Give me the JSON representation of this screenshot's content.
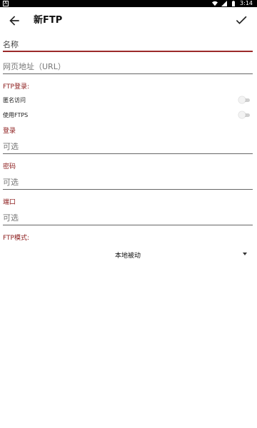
{
  "status_bar": {
    "left_icon": "A",
    "time": "3:14"
  },
  "app_bar": {
    "title": "新FTP"
  },
  "form": {
    "name_placeholder": "名称",
    "url_placeholder": "网页地址（URL）",
    "ftp_login_label": "FTP登录:",
    "anonymous_label": "匿名访问",
    "anonymous_enabled": false,
    "ftps_label": "使用FTPS",
    "ftps_enabled": false,
    "login_label": "登录",
    "login_placeholder": "可选",
    "password_label": "密码",
    "password_placeholder": "可选",
    "port_label": "端口",
    "port_placeholder": "可选",
    "ftp_mode_label": "FTP模式:",
    "ftp_mode_value": "本地被动"
  },
  "colors": {
    "accent": "#9c2a2a",
    "label_red": "#8b1a1a"
  }
}
